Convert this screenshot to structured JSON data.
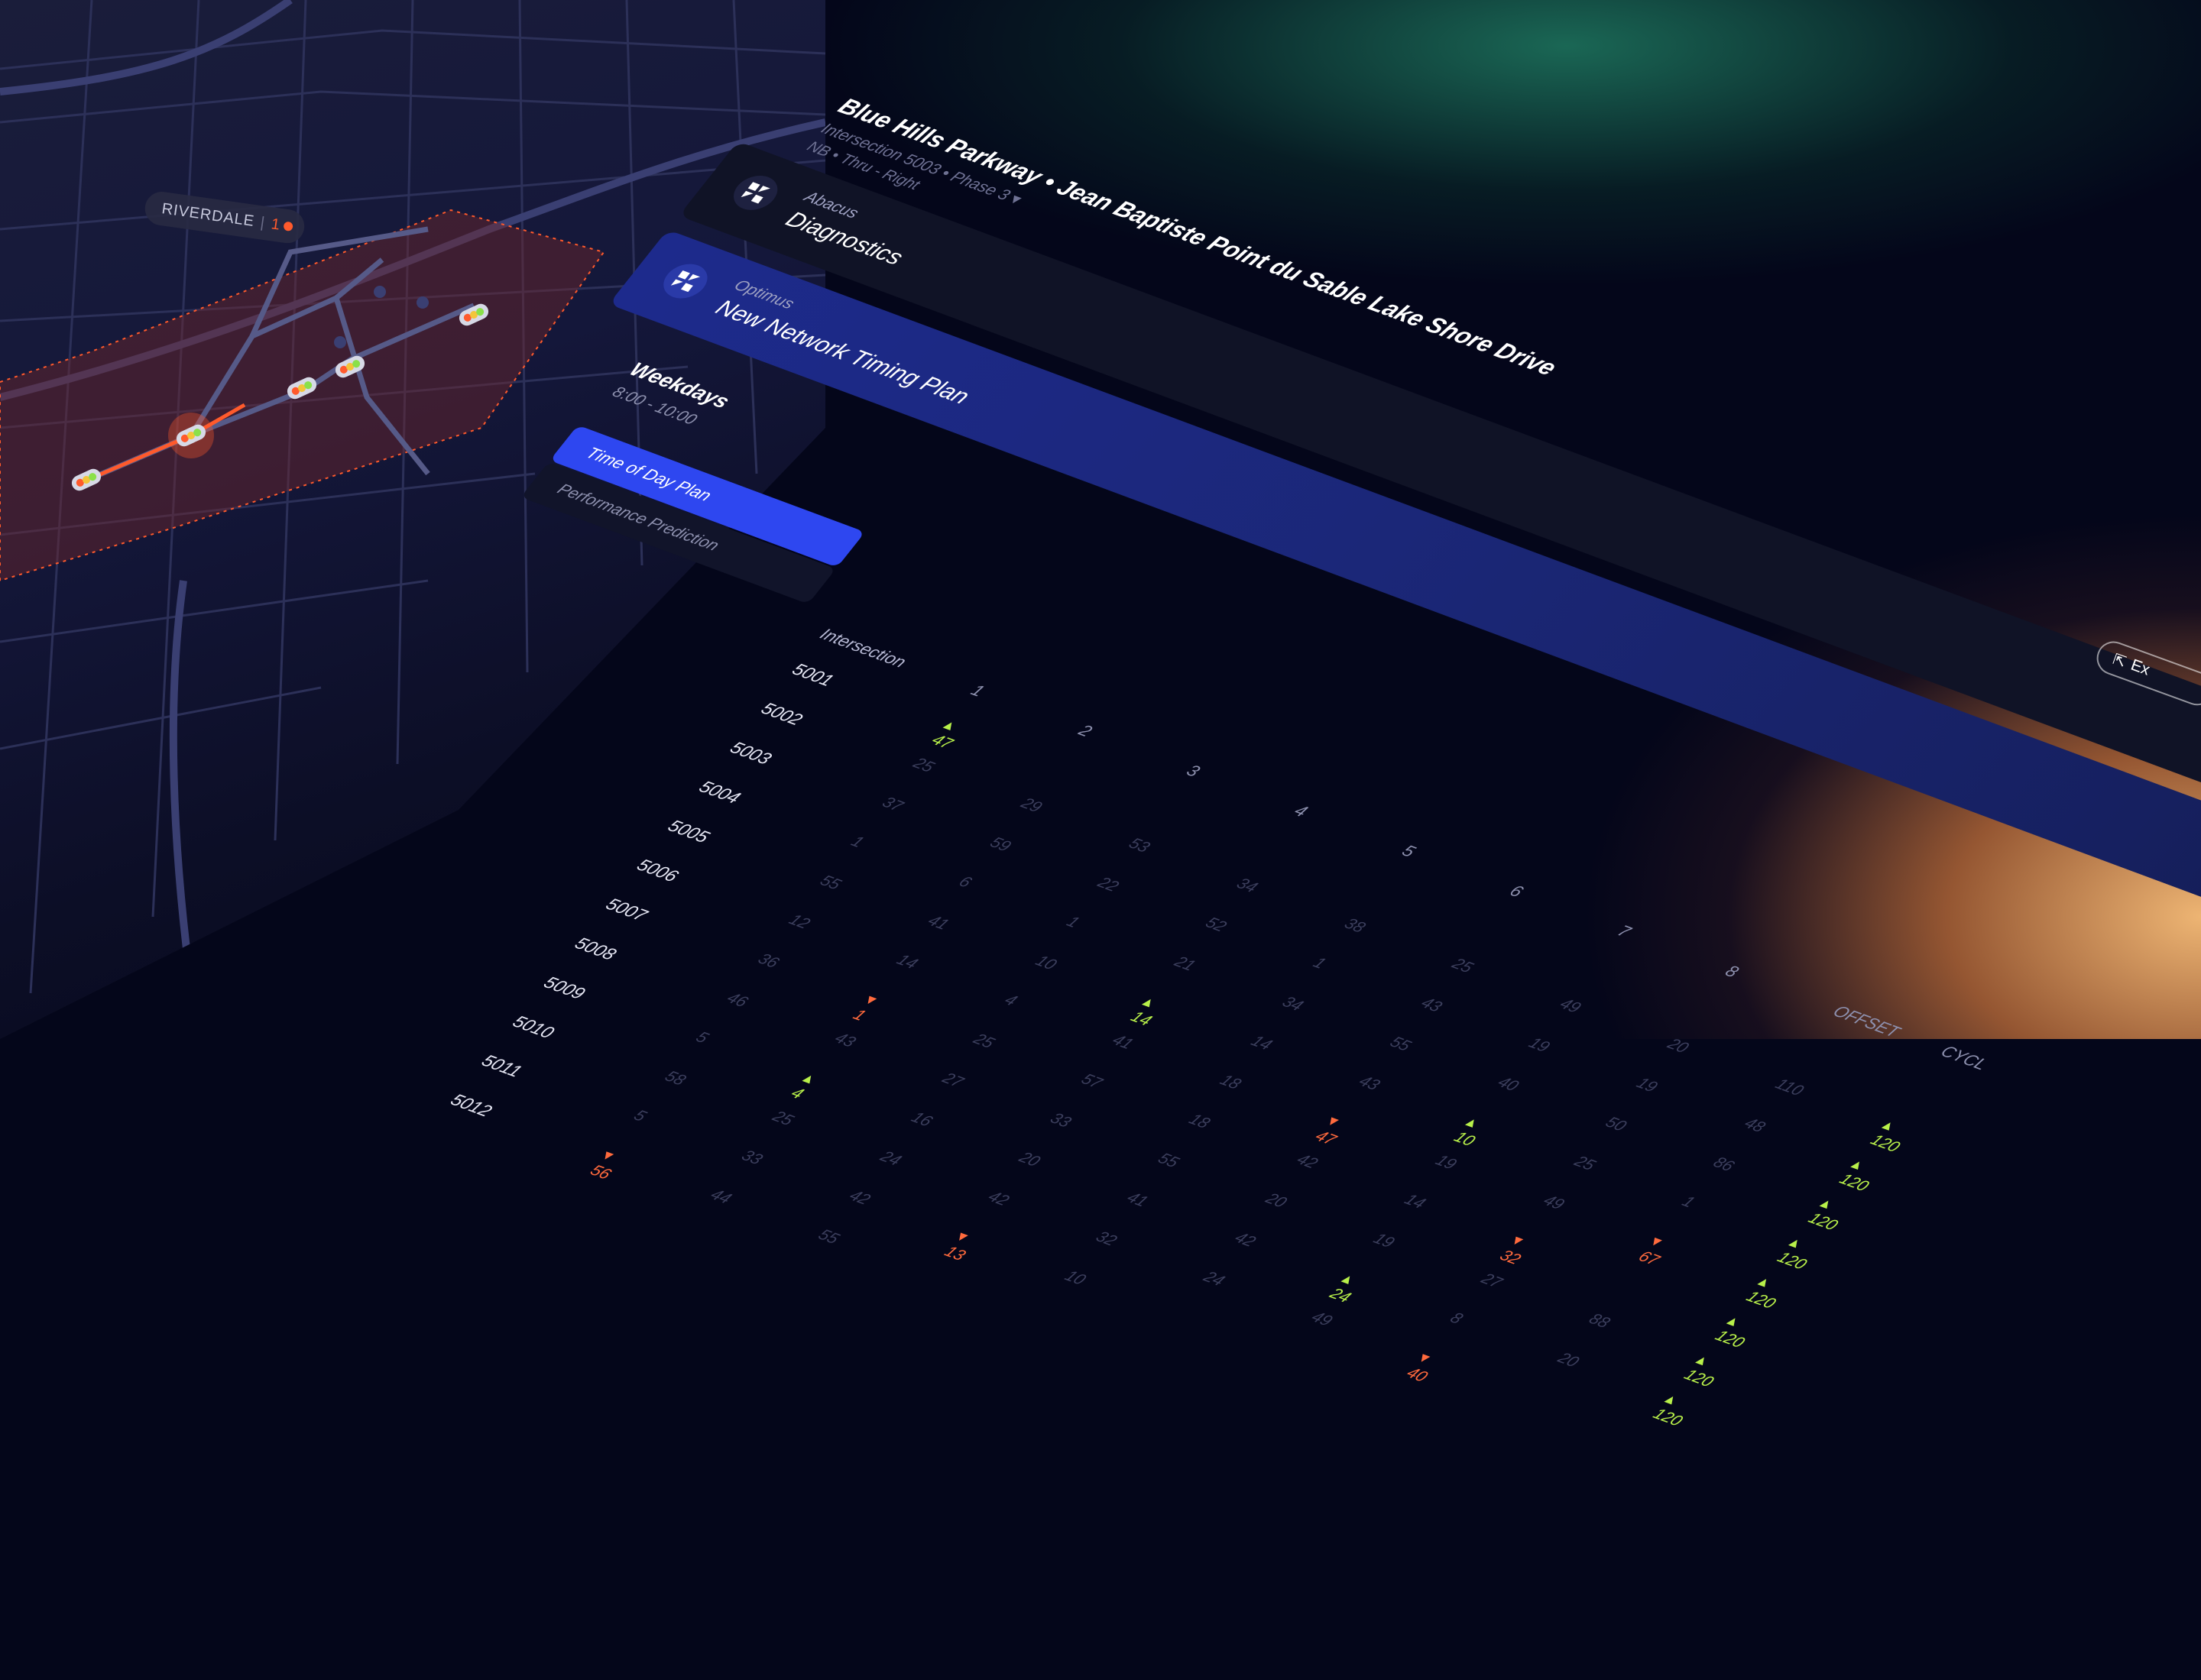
{
  "colors": {
    "background": "#04061a",
    "accent": "#2e47f0",
    "positive": "#b8f04a",
    "negative": "#ff6a3d",
    "zone": "#ff5a2c",
    "card": "#101326",
    "selected_card": "#1d2a8c"
  },
  "map": {
    "area_label": "RIVERDALE",
    "alert_count": "1"
  },
  "header": {
    "title": "Blue Hills Parkway  •  Jean Baptiste Point du Sable Lake Shore Drive",
    "subtitle": "Intersection 5003  •  Phase 3 ▾",
    "movement": "NB • Thru - Right"
  },
  "cards": [
    {
      "app": "Abacus",
      "label": "Diagnostics",
      "icon": "abacus-logo-icon"
    },
    {
      "app": "Optimus",
      "label": "New Network Timing Plan",
      "icon": "optimus-logo-icon"
    }
  ],
  "schedule": {
    "title": "Weekdays",
    "time": "8:00 - 10:00"
  },
  "tabs": [
    {
      "label": "Time of Day Plan",
      "active": true
    },
    {
      "label": "Performance Prediction",
      "active": false
    }
  ],
  "table": {
    "header_label": "Intersection",
    "columns": [
      "1",
      "2",
      "3",
      "4",
      "5",
      "6",
      "7",
      "8",
      "OFFSET",
      "CYCL"
    ],
    "rows": [
      {
        "id": "5001",
        "cells": [
          {
            "v": "47",
            "t": "pos"
          },
          {
            "v": "",
            "t": "off"
          },
          {
            "v": "",
            "t": "off"
          },
          {
            "v": "",
            "t": "off"
          },
          {
            "v": "",
            "t": "off"
          },
          {
            "v": "",
            "t": "off"
          },
          {
            "v": "",
            "t": "off"
          },
          {
            "v": "",
            "t": "off"
          },
          {
            "v": "",
            "t": "off"
          },
          {
            "v": "",
            "t": "off"
          }
        ]
      },
      {
        "id": "5002",
        "cells": [
          {
            "v": "25",
            "t": "off"
          },
          {
            "v": "29",
            "t": "off"
          },
          {
            "v": "53",
            "t": "off"
          },
          {
            "v": "34",
            "t": "off"
          },
          {
            "v": "38",
            "t": "off"
          },
          {
            "v": "25",
            "t": "off"
          },
          {
            "v": "49",
            "t": "off"
          },
          {
            "v": "20",
            "t": "off"
          },
          {
            "v": "110",
            "t": "off"
          },
          {
            "v": "120",
            "t": "pos"
          }
        ]
      },
      {
        "id": "5003",
        "cells": [
          {
            "v": "37",
            "t": "off"
          },
          {
            "v": "59",
            "t": "off"
          },
          {
            "v": "22",
            "t": "off"
          },
          {
            "v": "52",
            "t": "off"
          },
          {
            "v": "1",
            "t": "off"
          },
          {
            "v": "43",
            "t": "off"
          },
          {
            "v": "19",
            "t": "off"
          },
          {
            "v": "19",
            "t": "off"
          },
          {
            "v": "48",
            "t": "off"
          },
          {
            "v": "120",
            "t": "pos"
          }
        ]
      },
      {
        "id": "5004",
        "cells": [
          {
            "v": "1",
            "t": "off"
          },
          {
            "v": "6",
            "t": "off"
          },
          {
            "v": "1",
            "t": "off"
          },
          {
            "v": "21",
            "t": "off"
          },
          {
            "v": "34",
            "t": "off"
          },
          {
            "v": "55",
            "t": "off"
          },
          {
            "v": "40",
            "t": "off"
          },
          {
            "v": "50",
            "t": "off"
          },
          {
            "v": "86",
            "t": "off"
          },
          {
            "v": "120",
            "t": "pos"
          }
        ]
      },
      {
        "id": "5005",
        "cells": [
          {
            "v": "55",
            "t": "off"
          },
          {
            "v": "41",
            "t": "off"
          },
          {
            "v": "10",
            "t": "off"
          },
          {
            "v": "14",
            "t": "pos"
          },
          {
            "v": "14",
            "t": "off"
          },
          {
            "v": "43",
            "t": "off"
          },
          {
            "v": "10",
            "t": "pos"
          },
          {
            "v": "25",
            "t": "off"
          },
          {
            "v": "1",
            "t": "off"
          },
          {
            "v": "120",
            "t": "pos"
          }
        ]
      },
      {
        "id": "5006",
        "cells": [
          {
            "v": "12",
            "t": "off"
          },
          {
            "v": "14",
            "t": "off"
          },
          {
            "v": "4",
            "t": "off"
          },
          {
            "v": "41",
            "t": "off"
          },
          {
            "v": "18",
            "t": "off"
          },
          {
            "v": "47",
            "t": "neg"
          },
          {
            "v": "19",
            "t": "off"
          },
          {
            "v": "49",
            "t": "off"
          },
          {
            "v": "67",
            "t": "neg"
          },
          {
            "v": "120",
            "t": "pos"
          }
        ]
      },
      {
        "id": "5007",
        "cells": [
          {
            "v": "36",
            "t": "off"
          },
          {
            "v": "1",
            "t": "neg"
          },
          {
            "v": "25",
            "t": "off"
          },
          {
            "v": "57",
            "t": "off"
          },
          {
            "v": "18",
            "t": "off"
          },
          {
            "v": "42",
            "t": "off"
          },
          {
            "v": "14",
            "t": "off"
          },
          {
            "v": "32",
            "t": "neg"
          },
          {
            "v": "",
            "t": "off"
          },
          {
            "v": "120",
            "t": "pos"
          }
        ]
      },
      {
        "id": "5008",
        "cells": [
          {
            "v": "46",
            "t": "off"
          },
          {
            "v": "43",
            "t": "off"
          },
          {
            "v": "27",
            "t": "off"
          },
          {
            "v": "33",
            "t": "off"
          },
          {
            "v": "55",
            "t": "off"
          },
          {
            "v": "20",
            "t": "off"
          },
          {
            "v": "19",
            "t": "off"
          },
          {
            "v": "27",
            "t": "off"
          },
          {
            "v": "88",
            "t": "off"
          },
          {
            "v": "120",
            "t": "pos"
          }
        ]
      },
      {
        "id": "5009",
        "cells": [
          {
            "v": "5",
            "t": "off"
          },
          {
            "v": "4",
            "t": "pos"
          },
          {
            "v": "16",
            "t": "off"
          },
          {
            "v": "20",
            "t": "off"
          },
          {
            "v": "41",
            "t": "off"
          },
          {
            "v": "42",
            "t": "off"
          },
          {
            "v": "24",
            "t": "pos"
          },
          {
            "v": "8",
            "t": "off"
          },
          {
            "v": "20",
            "t": "off"
          },
          {
            "v": "120",
            "t": "pos"
          }
        ]
      },
      {
        "id": "5010",
        "cells": [
          {
            "v": "58",
            "t": "off"
          },
          {
            "v": "25",
            "t": "off"
          },
          {
            "v": "24",
            "t": "off"
          },
          {
            "v": "42",
            "t": "off"
          },
          {
            "v": "32",
            "t": "off"
          },
          {
            "v": "24",
            "t": "off"
          },
          {
            "v": "49",
            "t": "off"
          },
          {
            "v": "40",
            "t": "neg"
          },
          {
            "v": "",
            "t": "off"
          },
          {
            "v": "",
            "t": "off"
          }
        ]
      },
      {
        "id": "5011",
        "cells": [
          {
            "v": "5",
            "t": "off"
          },
          {
            "v": "33",
            "t": "off"
          },
          {
            "v": "42",
            "t": "off"
          },
          {
            "v": "13",
            "t": "neg"
          },
          {
            "v": "10",
            "t": "off"
          },
          {
            "v": "",
            "t": "off"
          },
          {
            "v": "",
            "t": "off"
          },
          {
            "v": "",
            "t": "off"
          },
          {
            "v": "",
            "t": "off"
          },
          {
            "v": "",
            "t": "off"
          }
        ]
      },
      {
        "id": "5012",
        "cells": [
          {
            "v": "56",
            "t": "neg"
          },
          {
            "v": "44",
            "t": "off"
          },
          {
            "v": "55",
            "t": "off"
          },
          {
            "v": "",
            "t": "off"
          },
          {
            "v": "",
            "t": "off"
          },
          {
            "v": "",
            "t": "off"
          },
          {
            "v": "",
            "t": "off"
          },
          {
            "v": "",
            "t": "off"
          },
          {
            "v": "",
            "t": "off"
          },
          {
            "v": "",
            "t": "off"
          }
        ]
      }
    ]
  },
  "export": {
    "label": "Ex",
    "icon": "export-icon"
  }
}
